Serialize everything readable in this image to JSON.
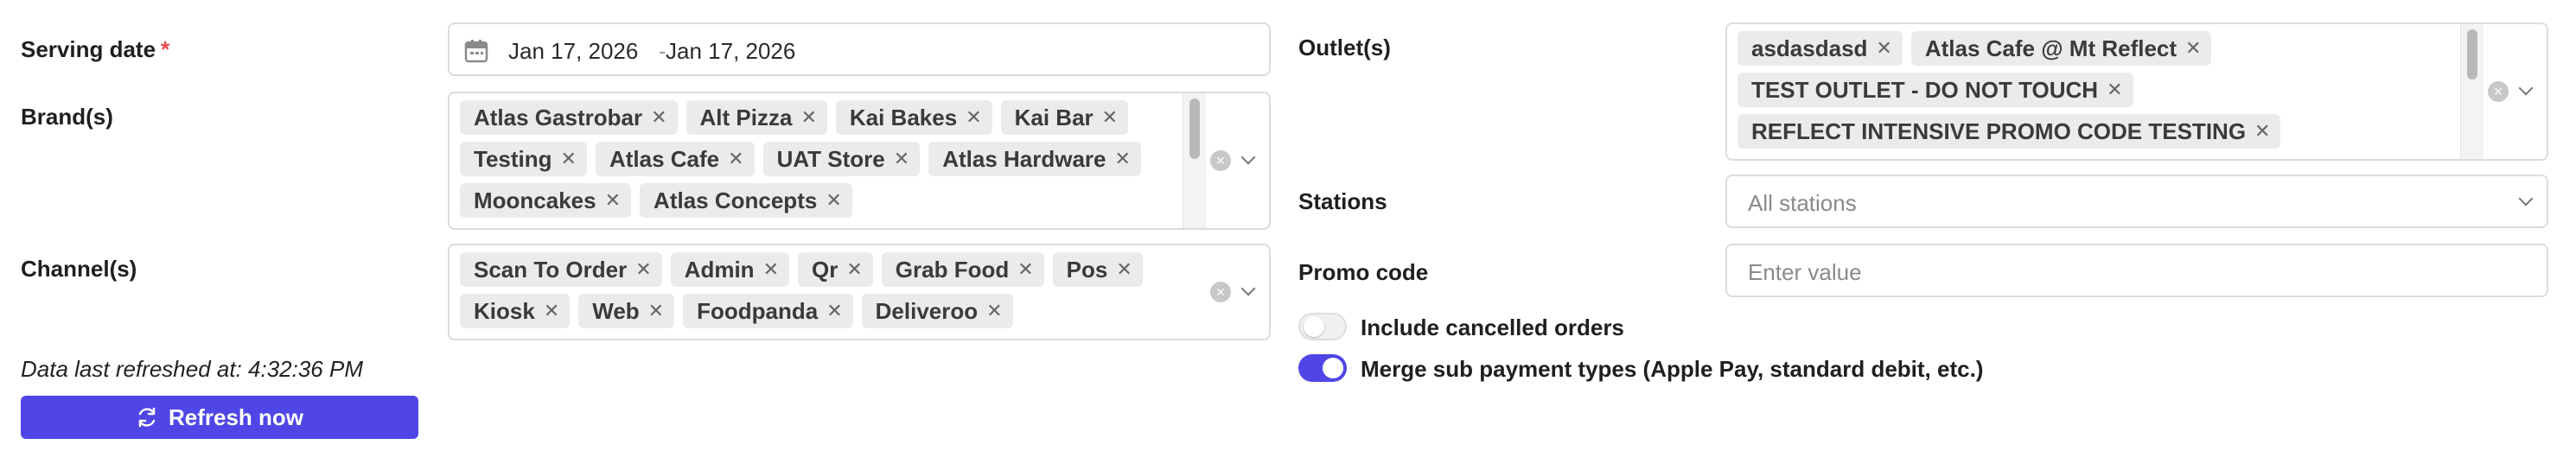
{
  "serving_date": {
    "label": "Serving date",
    "required_mark": "*",
    "start": "Jan 17, 2026",
    "separator": "-",
    "end": "Jan 17, 2026",
    "icon": "calendar-icon"
  },
  "brands": {
    "label": "Brand(s)",
    "tags": [
      "Atlas Gastrobar",
      "Alt Pizza",
      "Kai Bakes",
      "Kai Bar",
      "Testing",
      "Atlas Cafe",
      "UAT Store",
      "Atlas Hardware",
      "Mooncakes",
      "Atlas Concepts"
    ]
  },
  "channels": {
    "label": "Channel(s)",
    "tags": [
      "Scan To Order",
      "Admin",
      "Qr",
      "Grab Food",
      "Pos",
      "Kiosk",
      "Web",
      "Foodpanda",
      "Deliveroo"
    ]
  },
  "refresh": {
    "status": "Data last refreshed at: 4:32:36 PM",
    "button_label": "Refresh now"
  },
  "outlets": {
    "label": "Outlet(s)",
    "tags": [
      "asdasdasd",
      "Atlas Cafe @ Mt Reflect",
      "TEST OUTLET - DO NOT TOUCH",
      "REFLECT INTENSIVE PROMO CODE TESTING"
    ]
  },
  "stations": {
    "label": "Stations",
    "placeholder": "All stations"
  },
  "promo_code": {
    "label": "Promo code",
    "placeholder": "Enter value"
  },
  "toggles": {
    "include_cancelled": {
      "label": "Include cancelled orders",
      "on": false
    },
    "merge_sub_payment": {
      "label": "Merge sub payment types (Apple Pay, standard debit, etc.)",
      "on": true
    }
  },
  "colors": {
    "accent": "#4f46e5",
    "required": "#e5484d",
    "tag_bg": "#ebebeb"
  }
}
